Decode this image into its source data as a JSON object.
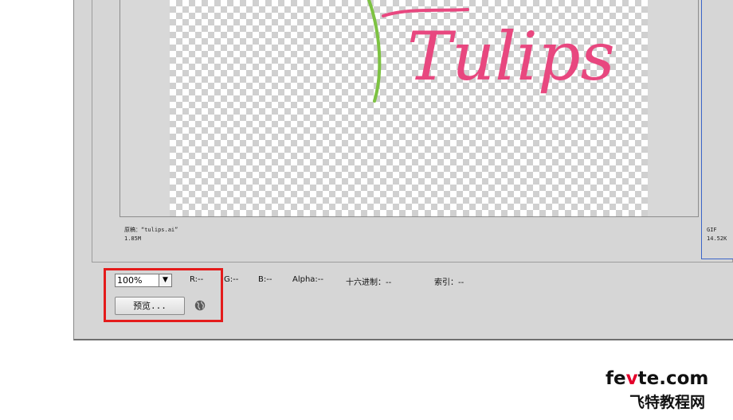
{
  "original": {
    "name_line": "原稿：“tulips.ai”",
    "size": "1.85M"
  },
  "optimized": {
    "format": "GIF",
    "size": "14.52K"
  },
  "artwork": {
    "text": "Tulips",
    "text_color": "#e8477f",
    "stem_color": "#7dc242"
  },
  "zoom": {
    "value": "100%"
  },
  "readouts": {
    "r": "R:--",
    "g": "G:--",
    "b": "B:--",
    "alpha": "Alpha:--",
    "hex": "十六进制：--",
    "index": "索引：--"
  },
  "preview_button": {
    "label": "预览..."
  },
  "highlight_color": "#e41b1b",
  "watermark": {
    "en_prefix": "fe",
    "en_accent": "v",
    "en_suffix": "te.com",
    "zh": "飞特教程网"
  }
}
